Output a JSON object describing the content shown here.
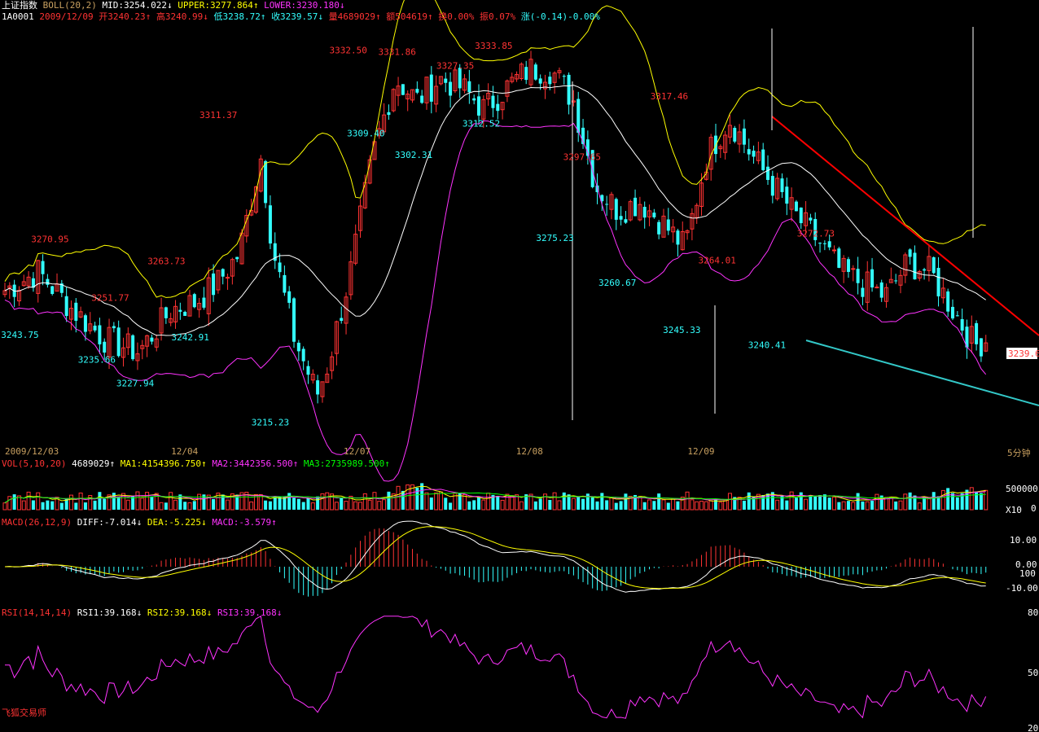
{
  "header": {
    "index_name": "上证指数",
    "boll_label": "BOLL(20,2)",
    "mid": "MID:3254.022↓",
    "upper": "UPPER:3277.864↑",
    "lower": "LOWER:3230.180↓",
    "code": "1A0001",
    "date": "2009/12/09",
    "open": "开3240.23↑",
    "high": "高3240.99↓",
    "low": "低3238.72↑",
    "close": "收3239.57↓",
    "volume": "量4689029↑",
    "amount": "额504619↑",
    "turnover": "换0.00%",
    "amplitude": "振0.07%",
    "change": "涨(-0.14)-0.00%"
  },
  "colors": {
    "up": "#ff3333",
    "down": "#33ffff",
    "upper": "#ffff00",
    "mid": "#ffffff",
    "lower": "#ff33ff",
    "trend_red": "#ff0000",
    "trend_cyan": "#33c8c8"
  },
  "price_panel": {
    "current_price": "3239.6",
    "annotations_high": [
      {
        "text": "3270.95",
        "x": 3.0,
        "color": "#ff3333"
      },
      {
        "text": "3251.77",
        "x": 8.8,
        "color": "#ff3333"
      },
      {
        "text": "3263.73",
        "x": 14.2,
        "color": "#ff3333"
      },
      {
        "text": "3311.37",
        "x": 19.2,
        "color": "#ff3333"
      },
      {
        "text": "3332.50",
        "x": 31.7,
        "color": "#ff3333"
      },
      {
        "text": "3331.86",
        "x": 36.4,
        "color": "#ff3333"
      },
      {
        "text": "3327.35",
        "x": 42.0,
        "color": "#ff3333"
      },
      {
        "text": "3333.85",
        "x": 45.7,
        "color": "#ff3333"
      },
      {
        "text": "3297.65",
        "x": 54.2,
        "color": "#ff3333"
      },
      {
        "text": "3317.46",
        "x": 62.6,
        "color": "#ff3333"
      },
      {
        "text": "3264.01",
        "x": 67.2,
        "color": "#ff3333"
      },
      {
        "text": "3272.73",
        "x": 76.7,
        "color": "#ff3333"
      }
    ],
    "annotations_low": [
      {
        "text": "3243.75",
        "x": 0.1,
        "color": "#33ffff"
      },
      {
        "text": "3235.66",
        "x": 7.5,
        "color": "#33ffff"
      },
      {
        "text": "3227.94",
        "x": 11.2,
        "color": "#33ffff"
      },
      {
        "text": "3242.91",
        "x": 16.5,
        "color": "#33ffff"
      },
      {
        "text": "3215.23",
        "x": 24.2,
        "color": "#33ffff"
      },
      {
        "text": "3309.40",
        "x": 33.4,
        "color": "#33ffff"
      },
      {
        "text": "3302.31",
        "x": 38.0,
        "color": "#33ffff"
      },
      {
        "text": "3312.52",
        "x": 44.5,
        "color": "#33ffff"
      },
      {
        "text": "3275.23",
        "x": 51.6,
        "color": "#33ffff"
      },
      {
        "text": "3260.67",
        "x": 57.6,
        "color": "#33ffff"
      },
      {
        "text": "3245.33",
        "x": 63.8,
        "color": "#33ffff"
      },
      {
        "text": "3240.41",
        "x": 72.0,
        "color": "#33ffff"
      }
    ]
  },
  "x_axis": {
    "dates": [
      {
        "label": "2009/12/03",
        "x": 0.0
      },
      {
        "label": "12/04",
        "x": 16.0
      },
      {
        "label": "12/07",
        "x": 32.6
      },
      {
        "label": "12/08",
        "x": 49.2
      },
      {
        "label": "12/09",
        "x": 65.7
      }
    ],
    "period": "5分钟"
  },
  "volume_panel": {
    "title": "VOL(5,10,20)",
    "value": "4689029↑",
    "ma1": "MA1:4154396.750↑",
    "ma2": "MA2:3442356.500↑",
    "ma3": "MA3:2735989.500↑",
    "axis_top": "500000",
    "axis_unit": "X10",
    "axis_zero": "0"
  },
  "macd_panel": {
    "title": "MACD(26,12,9)",
    "diff": "DIFF:-7.014↓",
    "dea": "DEA:-5.225↓",
    "macd": "MACD:-3.579↑",
    "ticks": [
      "10.00",
      "0.00",
      "100",
      "-10.00"
    ]
  },
  "rsi_panel": {
    "title": "RSI(14,14,14)",
    "rsi1": "RSI1:39.168↓",
    "rsi2": "RSI2:39.168↓",
    "rsi3": "RSI3:39.168↓",
    "ticks": [
      "80",
      "50",
      "20"
    ]
  },
  "watermark": "飞狐交易师",
  "chart_data": {
    "type": "candlestick",
    "instrument": "上证指数",
    "interval": "5分钟",
    "price_range": [
      3210,
      3340
    ],
    "annotated_highs": [
      3270.95,
      3251.77,
      3263.73,
      3311.37,
      3332.5,
      3331.86,
      3327.35,
      3333.85,
      3297.65,
      3317.46,
      3264.01,
      3272.73
    ],
    "annotated_lows": [
      3243.75,
      3235.66,
      3227.94,
      3242.91,
      3215.23,
      3309.4,
      3302.31,
      3312.52,
      3275.23,
      3260.67,
      3245.33,
      3240.41
    ],
    "last": {
      "open": 3240.23,
      "high": 3240.99,
      "low": 3238.72,
      "close": 3239.57,
      "volume": 4689029
    },
    "boll": {
      "mid": 3254.022,
      "upper": 3277.864,
      "lower": 3230.18
    },
    "macd": {
      "diff": -7.014,
      "dea": -5.225,
      "macd": -3.579
    },
    "rsi": {
      "rsi1": 39.168,
      "rsi2": 39.168,
      "rsi3": 39.168
    },
    "close_keypoints": [
      [
        0,
        3256
      ],
      [
        3,
        3262
      ],
      [
        6,
        3250
      ],
      [
        9,
        3240
      ],
      [
        12,
        3236
      ],
      [
        15,
        3250
      ],
      [
        17,
        3252
      ],
      [
        19,
        3258
      ],
      [
        21,
        3268
      ],
      [
        23,
        3300
      ],
      [
        24,
        3270
      ],
      [
        26,
        3240
      ],
      [
        28,
        3222
      ],
      [
        29,
        3232
      ],
      [
        31,
        3262
      ],
      [
        33,
        3300
      ],
      [
        35,
        3325
      ],
      [
        37,
        3318
      ],
      [
        39,
        3325
      ],
      [
        41,
        3322
      ],
      [
        43,
        3315
      ],
      [
        45,
        3322
      ],
      [
        47,
        3328
      ],
      [
        49,
        3328
      ],
      [
        51,
        3318
      ],
      [
        53,
        3290
      ],
      [
        55,
        3282
      ],
      [
        57,
        3285
      ],
      [
        59,
        3278
      ],
      [
        61,
        3270
      ],
      [
        63,
        3300
      ],
      [
        65,
        3312
      ],
      [
        67,
        3300
      ],
      [
        69,
        3290
      ],
      [
        71,
        3280
      ],
      [
        73,
        3272
      ],
      [
        75,
        3262
      ],
      [
        77,
        3258
      ],
      [
        79,
        3254
      ],
      [
        81,
        3265
      ],
      [
        83,
        3262
      ],
      [
        85,
        3250
      ],
      [
        87,
        3238
      ],
      [
        88,
        3240
      ]
    ]
  }
}
